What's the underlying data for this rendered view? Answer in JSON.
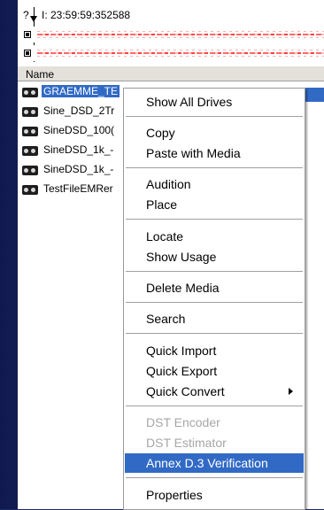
{
  "timebar": {
    "mark": "?",
    "time": "I: 23:59:59:352588"
  },
  "header": {
    "column_name": "Name"
  },
  "files": [
    {
      "name": "GRAEMME_TE",
      "selected": true
    },
    {
      "name": "Sine_DSD_2Tr"
    },
    {
      "name": "SineDSD_100("
    },
    {
      "name": "SineDSD_1k_-"
    },
    {
      "name": "SineDSD_1k_-"
    },
    {
      "name": "TestFileEMRer"
    }
  ],
  "context_menu": {
    "show_all_drives": "Show All Drives",
    "copy": "Copy",
    "paste_with_media": "Paste with Media",
    "audition": "Audition",
    "place": "Place",
    "locate": "Locate",
    "show_usage": "Show Usage",
    "delete_media": "Delete Media",
    "search": "Search",
    "quick_import": "Quick Import",
    "quick_export": "Quick Export",
    "quick_convert": "Quick Convert",
    "dst_encoder": "DST Encoder",
    "dst_estimator": "DST Estimator",
    "annex_verification": "Annex D.3 Verification",
    "properties": "Properties"
  },
  "colors": {
    "highlight": "#316ac5",
    "disabled_text": "#a6a6a6",
    "background": "#1a2a63"
  }
}
